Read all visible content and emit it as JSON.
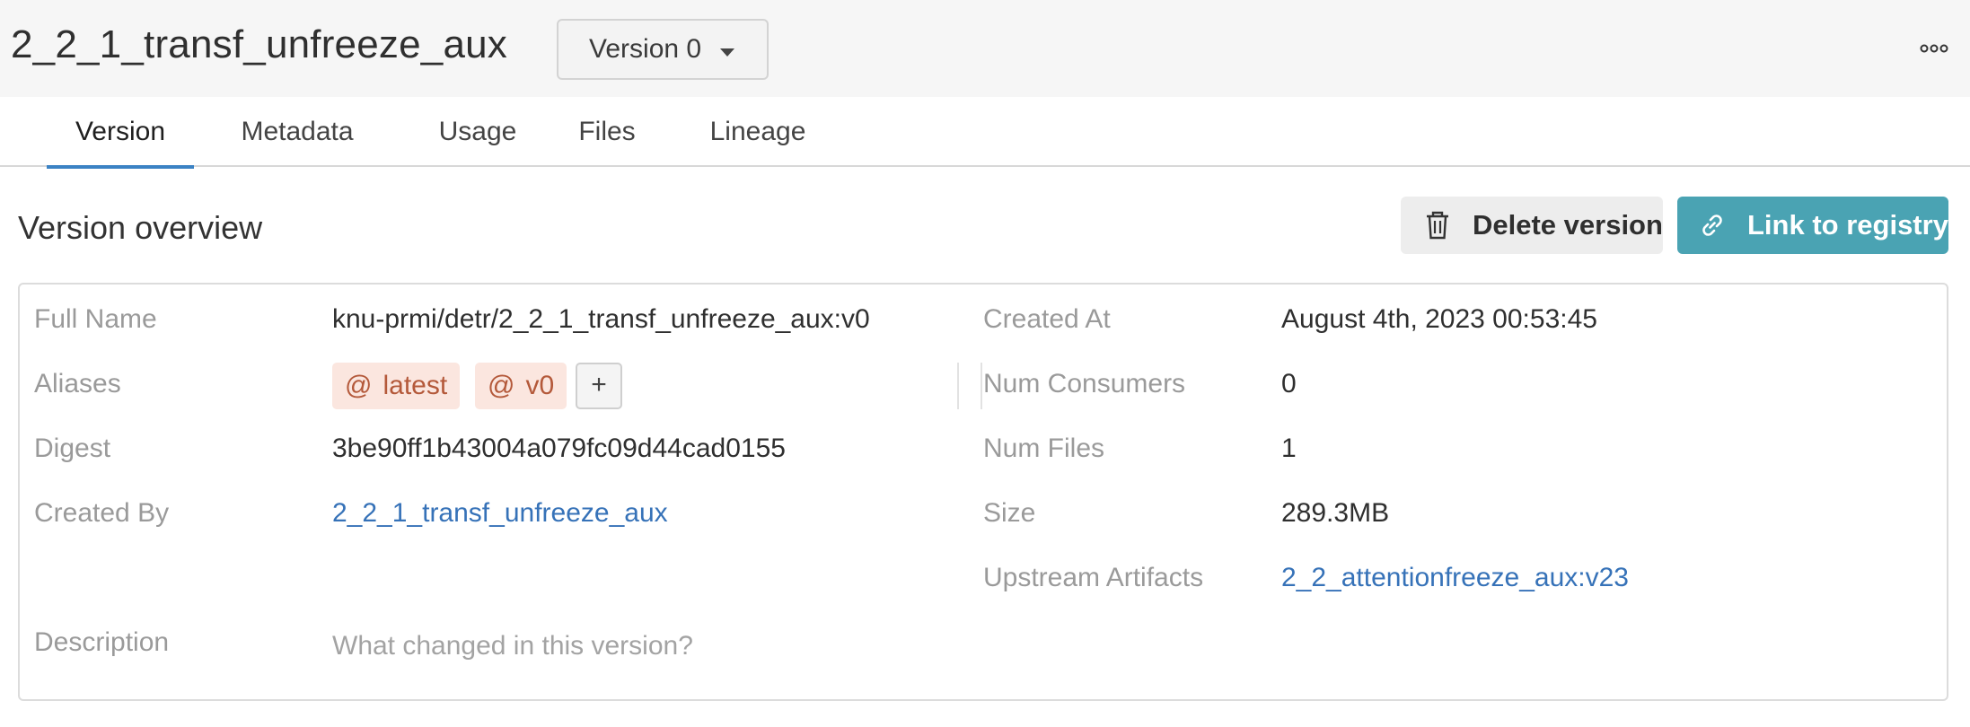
{
  "header": {
    "title": "2_2_1_transf_unfreeze_aux",
    "version_select": {
      "selected": "Version 0"
    },
    "more_icon": "ellipsis-horizontal-icon"
  },
  "tabs": [
    {
      "label": "Version",
      "active": true
    },
    {
      "label": "Metadata",
      "active": false
    },
    {
      "label": "Usage",
      "active": false
    },
    {
      "label": "Files",
      "active": false
    },
    {
      "label": "Lineage",
      "active": false
    }
  ],
  "overview": {
    "title": "Version overview",
    "delete_button": {
      "label": "Delete version",
      "icon": "trash-icon"
    },
    "link_button": {
      "label": "Link to registry",
      "icon": "link-icon"
    }
  },
  "details_left": {
    "full_name": {
      "label": "Full Name",
      "value": "knu-prmi/detr/2_2_1_transf_unfreeze_aux:v0"
    },
    "aliases": {
      "label": "Aliases",
      "tags": [
        "latest",
        "v0"
      ],
      "tag_prefix": "@",
      "add_label": "+"
    },
    "digest": {
      "label": "Digest",
      "value": "3be90ff1b43004a079fc09d44cad0155"
    },
    "created_by": {
      "label": "Created By",
      "value": "2_2_1_transf_unfreeze_aux"
    },
    "description": {
      "label": "Description",
      "placeholder": "What changed in this version?"
    }
  },
  "details_right": {
    "created_at": {
      "label": "Created At",
      "value": "August 4th, 2023 00:53:45"
    },
    "num_consumers": {
      "label": "Num Consumers",
      "value": "0"
    },
    "num_files": {
      "label": "Num Files",
      "value": "1"
    },
    "size": {
      "label": "Size",
      "value": "289.3MB"
    },
    "upstream_artifacts": {
      "label": "Upstream Artifacts",
      "value": "2_2_attentionfreeze_aux:v23"
    }
  },
  "colors": {
    "tab_indicator": "#3b82c4",
    "link": "#3672b8",
    "primary_button": "#4aa3b3",
    "alias_tag_bg": "#fbe6df",
    "alias_tag_text": "#b4593a"
  }
}
